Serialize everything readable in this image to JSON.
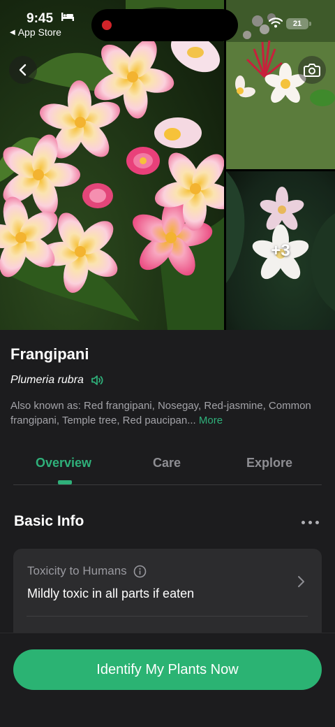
{
  "status_bar": {
    "time": "9:45",
    "back_app": "App Store",
    "battery": "21"
  },
  "gallery": {
    "more_photos": "+3"
  },
  "plant": {
    "common_name": "Frangipani",
    "scientific_name": "Plumeria rubra",
    "also_known_as": "Also known as: Red frangipani, Nosegay, Red-jasmine, Common frangipani, Temple tree, Red paucipan...",
    "more_label": "More"
  },
  "tabs": [
    {
      "label": "Overview",
      "active": true
    },
    {
      "label": "Care",
      "active": false
    },
    {
      "label": "Explore",
      "active": false
    }
  ],
  "basic_info": {
    "title": "Basic Info",
    "items": [
      {
        "label": "Toxicity to Humans",
        "value": "Mildly toxic in all parts if eaten"
      }
    ]
  },
  "cta": {
    "label": "Identify My Plants Now"
  },
  "colors": {
    "accent": "#2fb07a",
    "background": "#1c1c1e",
    "card": "#2c2c2e",
    "recording": "#d0242a"
  }
}
